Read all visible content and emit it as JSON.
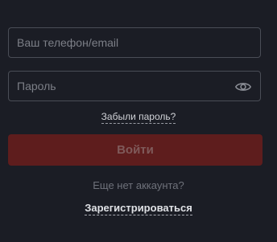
{
  "login_form": {
    "phone_placeholder": "Ваш телефон/email",
    "phone_value": "",
    "password_placeholder": "Пароль",
    "password_value": "",
    "show_password_icon": "eye-icon",
    "forgot_password_label": "Забыли пароль?",
    "submit_label": "Войти",
    "no_account_text": "Еще нет аккаунта?",
    "register_label": "Зарегистрироваться"
  },
  "colors": {
    "background": "#1b1d25",
    "field_border": "#4a4d56",
    "submit_bg": "#5e1d1d",
    "submit_text": "#7f5a5a",
    "muted_text": "#6e717a"
  }
}
